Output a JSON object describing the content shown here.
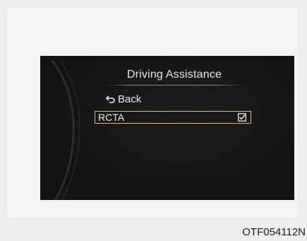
{
  "menu": {
    "title": "Driving Assistance",
    "back_label": "Back",
    "items": [
      {
        "label": "RCTA",
        "checked": true,
        "icon": "checkbox-checked-icon"
      }
    ]
  },
  "caption": {
    "code": "OTF054112N"
  },
  "colors": {
    "screen_background": "#141414",
    "selection_border": "#d4c27a",
    "text": "#ececec"
  }
}
